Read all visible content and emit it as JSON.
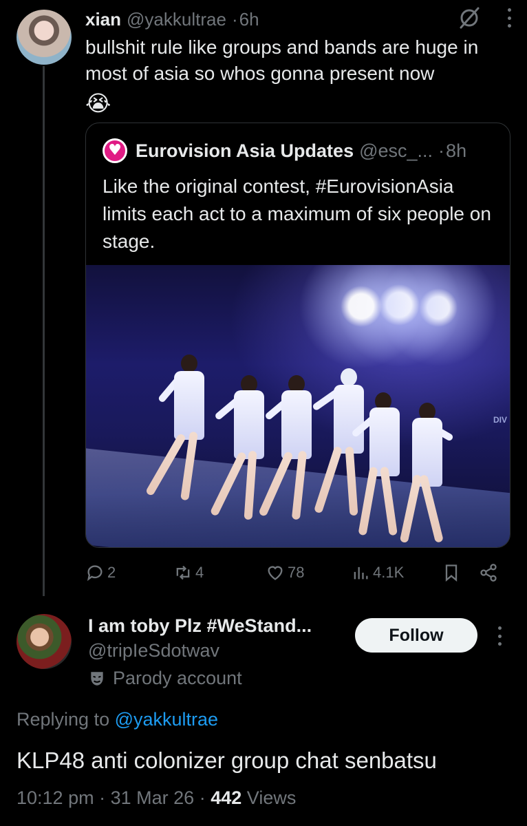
{
  "tweet": {
    "author_name": "xian",
    "handle": "@yakkultrae",
    "separator": "·",
    "time": "6h",
    "text": "bullshit rule like groups and bands are huge in most of asia so whos gonna present now",
    "emoji": "😭"
  },
  "quote": {
    "author_name": "Eurovision Asia Updates",
    "handle": "@esc_...",
    "separator": "·",
    "time": "8h",
    "text": "Like the original contest, #EurovisionAsia limits each act to a maximum of six people on stage.",
    "image_logo_text": "DIV"
  },
  "actions": {
    "replies": "2",
    "reposts": "4",
    "likes": "78",
    "views": "4.1K"
  },
  "reply": {
    "author_name": "I am toby Plz #WeStand...",
    "handle": "@tripIeSdotwav",
    "parody_label": "Parody account",
    "follow_label": "Follow",
    "replying_prefix": "Replying to",
    "replying_to": "@yakkultrae",
    "text": "KLP48 anti colonizer group chat senbatsu",
    "time": "10:12 pm",
    "sep1": "·",
    "date": "31 Mar 26",
    "sep2": "·",
    "views_count": "442",
    "views_label": "Views"
  },
  "colors": {
    "background": "#000000",
    "text": "#e7e9ea",
    "muted": "#71767b",
    "link": "#1d9bf0",
    "quote_avatar": "#e01b84"
  }
}
